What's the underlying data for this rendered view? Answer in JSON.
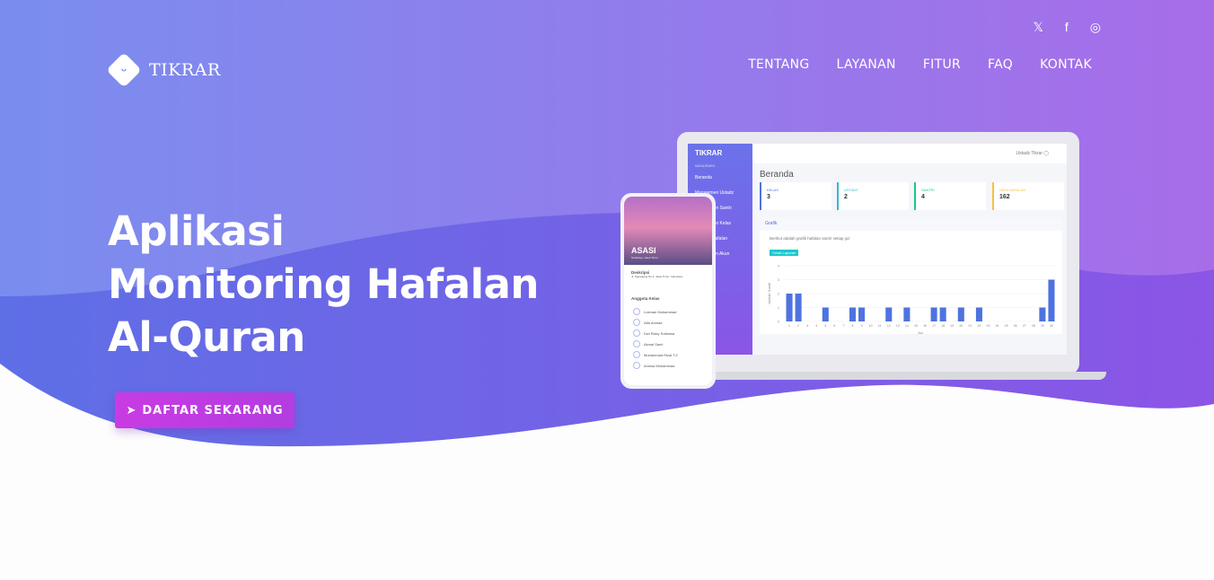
{
  "brand": {
    "name": "TIKRAR",
    "logo_icon": "smile-diamond-icon"
  },
  "social": [
    {
      "icon": "twitter-icon",
      "glyph": "𝕏"
    },
    {
      "icon": "facebook-icon",
      "glyph": "f"
    },
    {
      "icon": "instagram-icon",
      "glyph": "◎"
    }
  ],
  "nav": [
    {
      "label": "TENTANG"
    },
    {
      "label": "LAYANAN"
    },
    {
      "label": "FITUR"
    },
    {
      "label": "FAQ"
    },
    {
      "label": "KONTAK"
    }
  ],
  "hero": {
    "line1": "Aplikasi",
    "line2": "Monitoring Hafalan",
    "line3": "Al-Quran",
    "cta": "DAFTAR SEKARANG",
    "cta_icon": "paper-plane-icon"
  },
  "colors": {
    "bg_left": "#7a8cef",
    "bg_right": "#a56ee8",
    "cta": "#c23de0"
  },
  "dashboard": {
    "brand": "TIKRAR",
    "section": "MANAJEMEN",
    "sidebar": [
      "Beranda",
      "Manajemen Ustadz",
      "Manajemen Santri",
      "Manajemen Kelas",
      "Setoran Hafalan",
      "Pengaturan Akun"
    ],
    "user": "Ustadz Tikrar",
    "title": "Beranda",
    "cards": [
      {
        "label": "KELAS",
        "value": "3",
        "color": "#4e73df"
      },
      {
        "label": "USTADZ",
        "value": "2",
        "color": "#36b9cc"
      },
      {
        "label": "SANTRI",
        "value": "4",
        "color": "#1cc88a"
      },
      {
        "label": "DATA HAFALAN",
        "value": "162",
        "color": "#f6c23e"
      }
    ],
    "panel_title": "Grafik",
    "desc": "Berikut adalah grafik hafalan santri setiap juz",
    "print_button": "Cetak Laporan"
  },
  "chart_data": {
    "type": "bar",
    "xlabel": "Juz",
    "ylabel": "Jumlah Santri",
    "ylim": [
      0,
      4
    ],
    "yticks": [
      0,
      1,
      2,
      3,
      4
    ],
    "categories": [
      1,
      2,
      3,
      4,
      5,
      6,
      7,
      8,
      9,
      10,
      11,
      12,
      13,
      14,
      15,
      16,
      17,
      18,
      19,
      20,
      21,
      22,
      23,
      24,
      25,
      26,
      27,
      28,
      29,
      30
    ],
    "values": [
      2,
      2,
      0,
      0,
      1,
      0,
      0,
      1,
      1,
      0,
      0,
      1,
      0,
      1,
      0,
      0,
      1,
      1,
      0,
      1,
      0,
      1,
      0,
      0,
      0,
      0,
      0,
      0,
      1,
      3
    ],
    "color": "#4e73df",
    "grid": true
  },
  "phone": {
    "title": "ASASI",
    "subtitle": "Surabaya, Jawa Timur",
    "desc_title": "Deskripsi",
    "desc": "Jl. Sepanjang No.1, Jawa Timur, Indonesia",
    "members_title": "Anggota Kelas",
    "members": [
      "Lukman Muhammad",
      "Alfa Ahmad",
      "Dwi Rizky Sofiansa",
      "Akmal Sami",
      "Muhammad Rizal T.Z",
      "Annisa Muhammad"
    ],
    "badge": "Ustadz"
  }
}
